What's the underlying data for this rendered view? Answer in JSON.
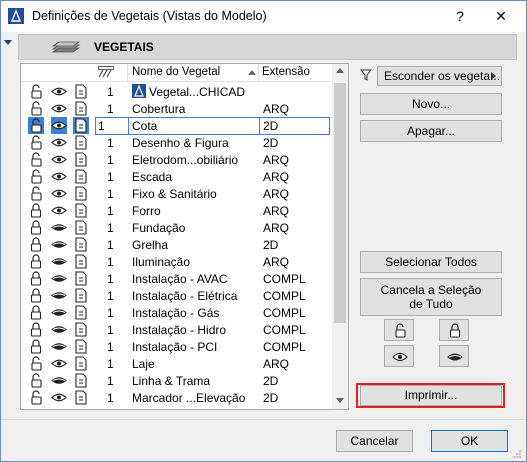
{
  "window": {
    "title": "Definições de Vegetais (Vistas do Modelo)",
    "help": "?",
    "close": "✕"
  },
  "header": {
    "label": "VEGETAIS"
  },
  "list": {
    "columns": {
      "name": "Nome do Vegetal",
      "extension": "Extensão"
    },
    "rows": [
      {
        "locked": false,
        "visible": true,
        "num": "1",
        "name": "Vegetal...CHICAD",
        "ext": "",
        "has_icon": true
      },
      {
        "locked": false,
        "visible": true,
        "num": "1",
        "name": "Cobertura",
        "ext": "ARQ"
      },
      {
        "locked": false,
        "visible": true,
        "num": "1",
        "name": "Cota",
        "ext": "2D",
        "selected": true
      },
      {
        "locked": false,
        "visible": true,
        "num": "1",
        "name": "Desenho & Figura",
        "ext": "2D"
      },
      {
        "locked": false,
        "visible": true,
        "num": "1",
        "name": "Eletrodom...obiliário",
        "ext": "ARQ"
      },
      {
        "locked": false,
        "visible": true,
        "num": "1",
        "name": "Escada",
        "ext": "ARQ"
      },
      {
        "locked": false,
        "visible": true,
        "num": "1",
        "name": "Fixo & Sanitário",
        "ext": "ARQ"
      },
      {
        "locked": true,
        "visible": true,
        "num": "1",
        "name": "Forro",
        "ext": "ARQ"
      },
      {
        "locked": true,
        "visible": false,
        "num": "1",
        "name": "Fundação",
        "ext": "ARQ"
      },
      {
        "locked": true,
        "visible": false,
        "num": "1",
        "name": "Grelha",
        "ext": "2D"
      },
      {
        "locked": true,
        "visible": false,
        "num": "1",
        "name": "Iluminação",
        "ext": "ARQ"
      },
      {
        "locked": true,
        "visible": false,
        "num": "1",
        "name": "Instalação - AVAC",
        "ext": "COMPL"
      },
      {
        "locked": true,
        "visible": false,
        "num": "1",
        "name": "Instalação - Elétrica",
        "ext": "COMPL"
      },
      {
        "locked": true,
        "visible": false,
        "num": "1",
        "name": "Instalação - Gás",
        "ext": "COMPL"
      },
      {
        "locked": true,
        "visible": false,
        "num": "1",
        "name": "Instalação - Hidro",
        "ext": "COMPL"
      },
      {
        "locked": true,
        "visible": false,
        "num": "1",
        "name": "Instalação - PCI",
        "ext": "COMPL"
      },
      {
        "locked": false,
        "visible": true,
        "num": "1",
        "name": "Laje",
        "ext": "ARQ"
      },
      {
        "locked": false,
        "visible": false,
        "num": "1",
        "name": "Linha & Trama",
        "ext": "2D"
      },
      {
        "locked": false,
        "visible": true,
        "num": "1",
        "name": "Marcador ...Elevação",
        "ext": "2D"
      }
    ]
  },
  "sidebar": {
    "filter_value": "Esconder os vegeta...",
    "new_label": "Novo...",
    "delete_label": "Apagar...",
    "select_all_label": "Selecionar Todos",
    "deselect_line1": "Cancela a Seleção",
    "deselect_line2": "de Tudo",
    "print_label": "Imprimir..."
  },
  "footer": {
    "cancel_label": "Cancelar",
    "ok_label": "OK"
  }
}
